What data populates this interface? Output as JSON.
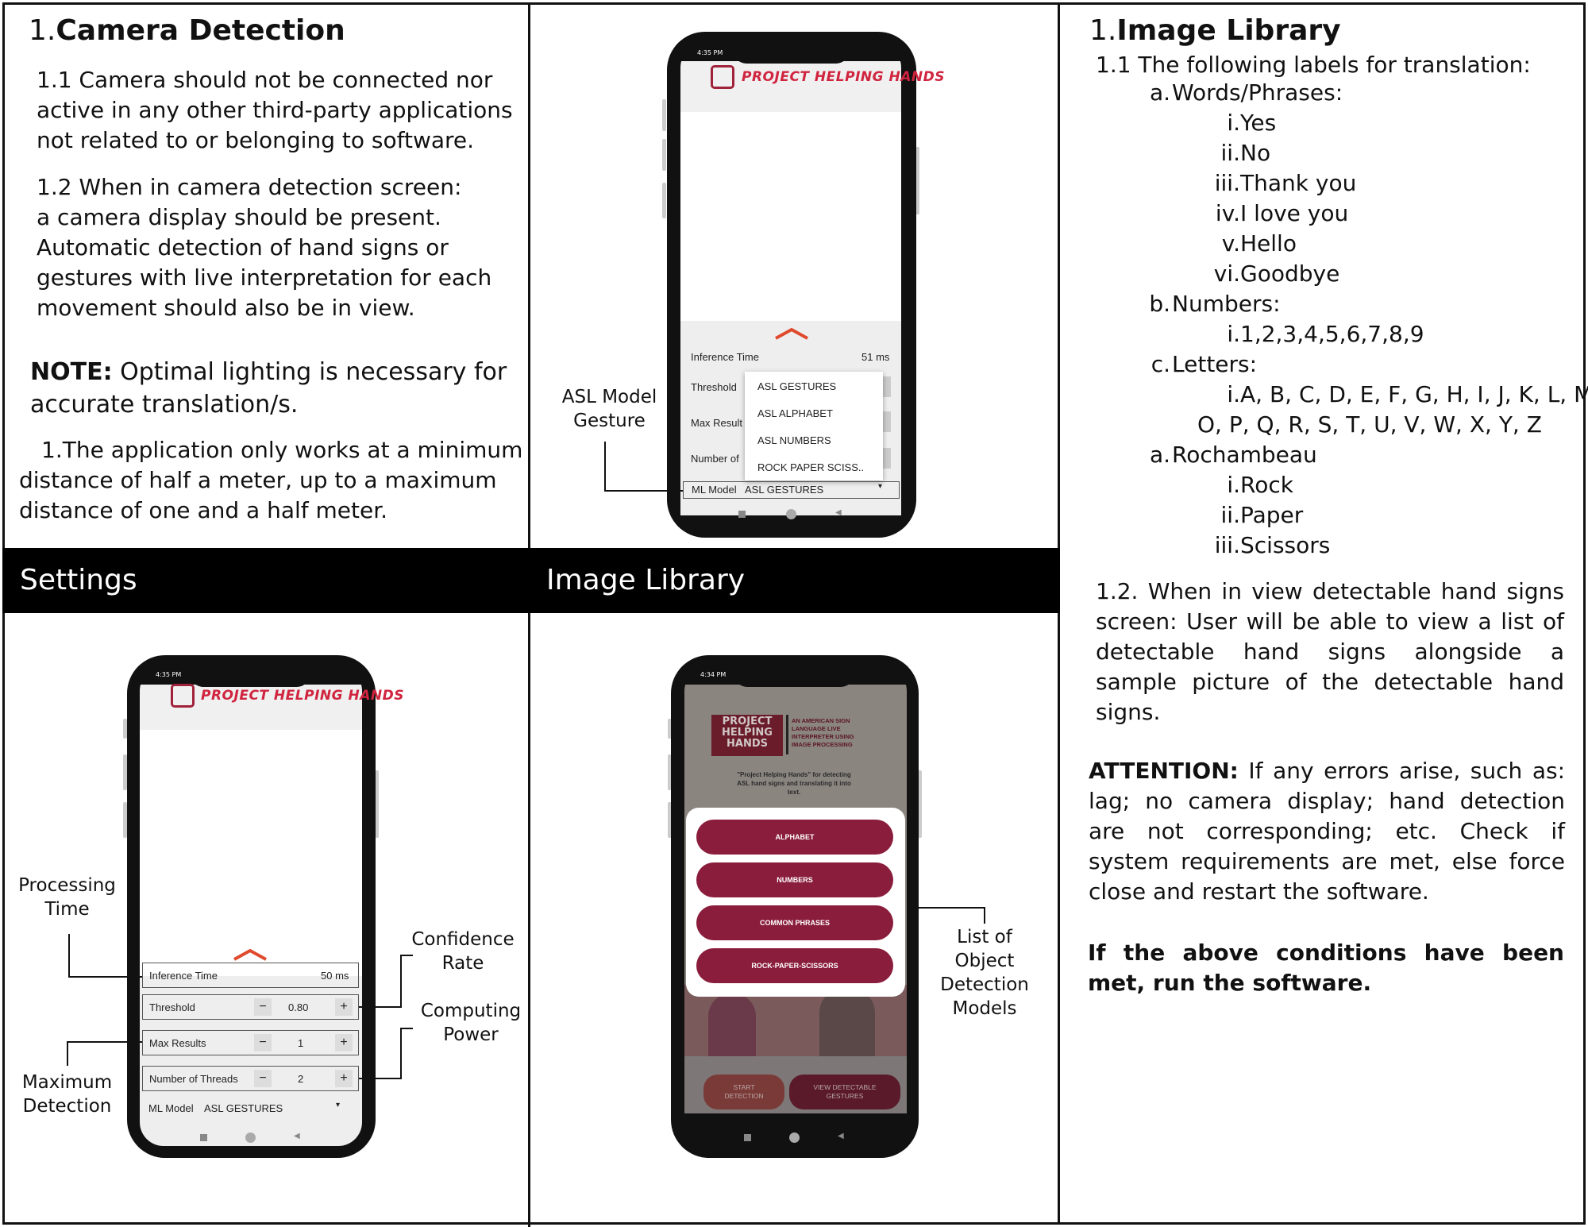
{
  "left": {
    "heading_num": "1.",
    "heading": "Camera Detection",
    "p1_1": "1.1 Camera should not be connected nor",
    "p1_2": "active in any other third-party applications",
    "p1_3": "not related to or belonging to software.",
    "p2_1": "1.2 When in camera detection screen:",
    "p2_2": "a camera display should be present.",
    "p2_3": "Automatic detection of hand signs or",
    "p2_4": "gestures with live interpretation for each",
    "p2_5": "movement should also be in view.",
    "note_label": "NOTE:",
    "note_1": " Optimal lighting is necessary for",
    "note_2": "accurate translation/s.",
    "list_1": "1.The application only works at a minimum",
    "list_2": "distance of half a meter, up to a maximum",
    "list_3": "distance of one and a half meter."
  },
  "bands": {
    "settings": "Settings",
    "image_library": "Image Library"
  },
  "top_phone": {
    "time": "4:35 PM",
    "logo": "PROJECT HELPING HANDS",
    "inference_label": "Inference Time",
    "inference_value": "51 ms",
    "threshold_label": "Threshold",
    "max_label": "Max Result",
    "threads_label": "Number of",
    "model_label": "ML Model",
    "model_value": "ASL GESTURES",
    "dropdown": [
      "ASL GESTURES",
      "ASL ALPHABET",
      "ASL NUMBERS",
      "ROCK PAPER SCISS.."
    ]
  },
  "callouts": {
    "asl_model": [
      "ASL Model",
      "Gesture"
    ],
    "processing": [
      "Processing",
      "Time"
    ],
    "confidence": [
      "Confidence",
      "Rate"
    ],
    "computing": [
      "Computing",
      "Power"
    ],
    "maximum": [
      "Maximum",
      "Detection"
    ],
    "list_models": [
      "List of",
      "Object",
      "Detection",
      "Models"
    ]
  },
  "settings_phone": {
    "time": "4:35 PM",
    "logo": "PROJECT HELPING HANDS",
    "inference_label": "Inference Time",
    "inference_value": "50 ms",
    "threshold_label": "Threshold",
    "threshold_value": "0.80",
    "max_label": "Max Results",
    "max_value": "1",
    "threads_label": "Number of Threads",
    "threads_value": "2",
    "model_label": "ML Model",
    "model_value": "ASL GESTURES",
    "minus": "−",
    "plus": "+"
  },
  "library_phone": {
    "time": "4:34 PM",
    "brand_lines": [
      "PROJECT",
      "HELPING",
      "HANDS"
    ],
    "tag_lines": [
      "AN AMERICAN SIGN",
      "LANGUAGE LIVE",
      "INTERPRETER USING",
      "IMAGE PROCESSING"
    ],
    "desc_lines": [
      "\"Project Helping Hands\" for detecting",
      "ASL hand signs and translating it into",
      "text."
    ],
    "buttons": [
      "ALPHABET",
      "NUMBERS",
      "COMMON PHRASES",
      "ROCK-PAPER-SCISSORS"
    ],
    "start": [
      "START",
      "DETECTION"
    ],
    "view": [
      "VIEW DETECTABLE",
      "GESTURES"
    ]
  },
  "right": {
    "heading_num": "1.",
    "heading": "Image Library",
    "intro": "1.1 The following labels for translation:",
    "items": [
      {
        "m": "a.",
        "t": "Words/Phrases:"
      },
      {
        "m": "i.",
        "t": "Yes"
      },
      {
        "m": "ii.",
        "t": "No"
      },
      {
        "m": "iii.",
        "t": "Thank you"
      },
      {
        "m": "iv.",
        "t": "I love you"
      },
      {
        "m": "v.",
        "t": "Hello"
      },
      {
        "m": "vi.",
        "t": "Goodbye"
      },
      {
        "m": "b.",
        "t": "Numbers:"
      },
      {
        "m": "i.",
        "t": "1,2,3,4,5,6,7,8,9"
      },
      {
        "m": "c.",
        "t": "Letters:"
      },
      {
        "m": "i.",
        "t": "A, B, C, D, E, F, G, H, I, J, K, L, M, N,"
      },
      {
        "m": "",
        "t": "O, P, Q, R, S, T, U, V, W, X, Y, Z"
      },
      {
        "m": "a.",
        "t": "Rochambeau"
      },
      {
        "m": "i.",
        "t": "Rock"
      },
      {
        "m": "ii.",
        "t": "Paper"
      },
      {
        "m": "iii.",
        "t": "Scissors"
      }
    ],
    "p12": "1.2. When in view detectable hand signs screen: User will be able to view a list of detectable hand signs alongside a sample picture of the detectable hand signs.",
    "attention_label": "ATTENTION:",
    "attention": " If any errors arise, such as: lag; no camera display; hand detection are not corresponding; etc. Check if system requirements are met, else force close and restart the software.",
    "final": "If the above conditions have been met, run the software."
  }
}
